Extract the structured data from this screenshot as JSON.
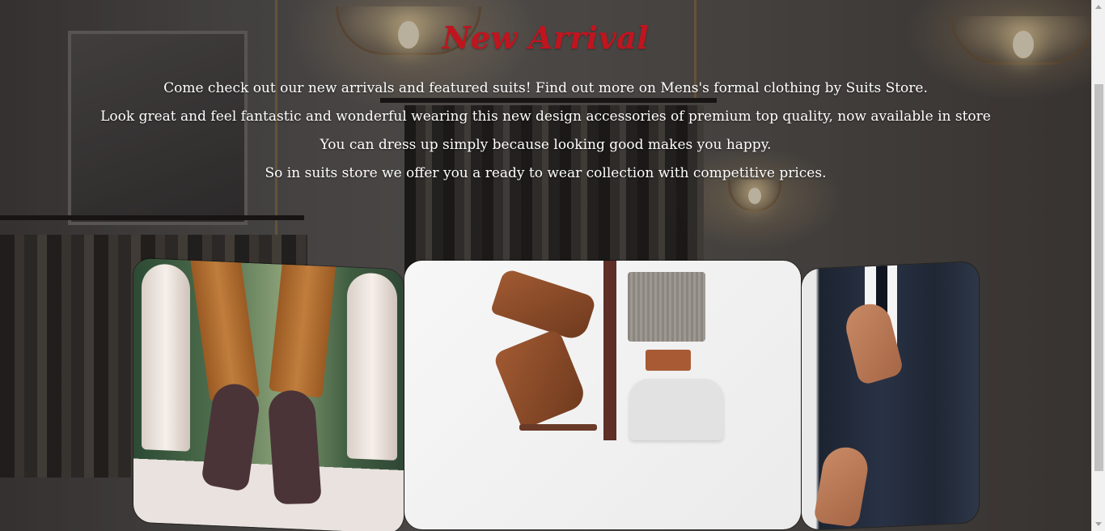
{
  "page": {
    "heading": "New Arrival",
    "lines": [
      "Come check out our new arrivals and featured suits! Find out more on Mens's formal clothing by Suits Store.",
      "Look great and feel fantastic and wonderful wearing this new design accessories of premium top quality, now available in store",
      "You can dress up simply because looking good makes you happy.",
      "So in suits store we offer you a ready to wear collection with competitive prices."
    ]
  },
  "colors": {
    "heading": "#c0151f",
    "text": "#ffffff"
  },
  "gallery": {
    "images": [
      {
        "name": "sneakers-photo"
      },
      {
        "name": "flatlay-accessories-photo"
      },
      {
        "name": "suit-tie-photo"
      }
    ]
  }
}
